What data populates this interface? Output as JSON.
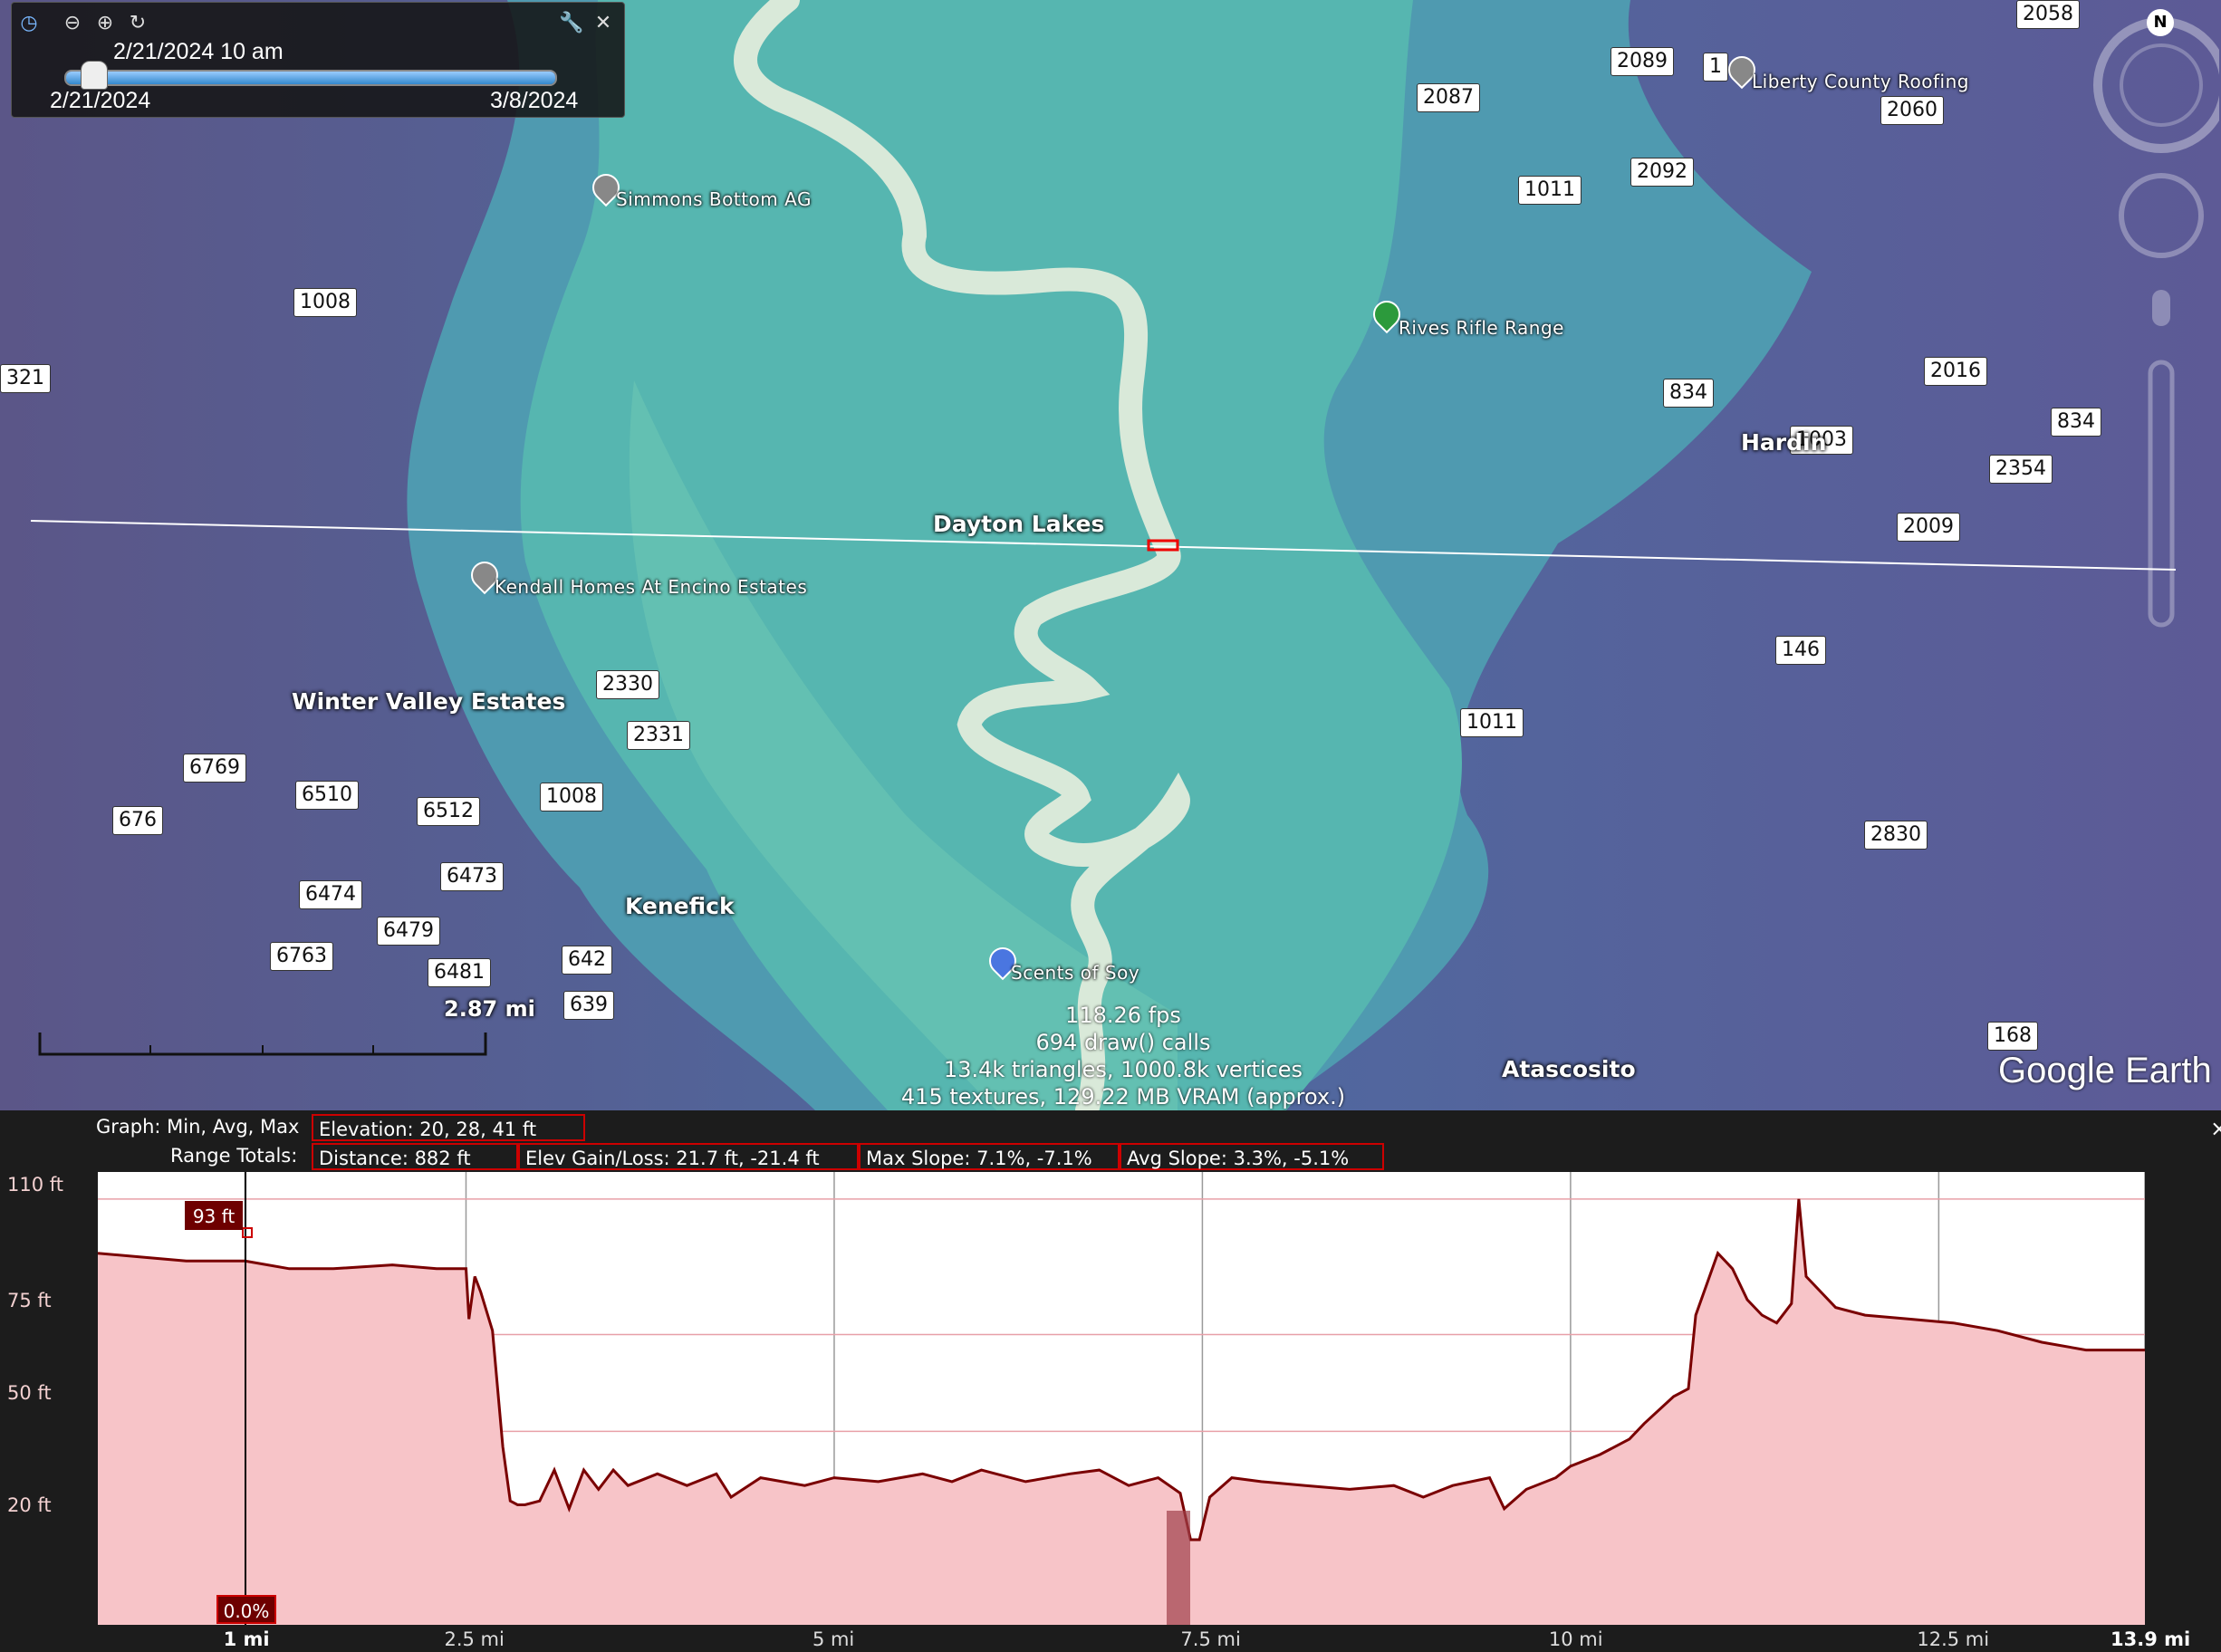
{
  "timebar": {
    "current": "2/21/2024  10 am",
    "start": "2/21/2024",
    "end": "3/8/2024",
    "icons": [
      "clock-icon",
      "zoom-out-icon",
      "zoom-in-icon",
      "refresh-icon",
      "wrench-icon",
      "close-icon"
    ]
  },
  "map": {
    "places": {
      "dayton_lakes": "Dayton Lakes",
      "winter_valley": "Winter Valley Estates",
      "kenefick": "Kenefick",
      "hardin": "Hardin",
      "atascosito": "Atascosito"
    },
    "pois": {
      "simmons": "Simmons Bottom AG",
      "rives": "Rives Rifle Range",
      "kendall": "Kendall Homes At Encino Estates",
      "scents": "Scents of Soy",
      "liberty": "Liberty County Roofing"
    },
    "shields": {
      "r2058": "2058",
      "r2089": "2089",
      "r2087": "2087",
      "r2060": "2060",
      "r2092": "2092",
      "r1011a": "1011",
      "r1008a": "1008",
      "r321": "321",
      "r834a": "834",
      "r2016": "2016",
      "r834b": "834",
      "r1003": "1003",
      "r2354": "2354",
      "r2009": "2009",
      "r146": "146",
      "r2330": "2330",
      "r2331": "2331",
      "r1011b": "1011",
      "r6769": "6769",
      "r676": "676",
      "r6510": "6510",
      "r6512": "6512",
      "r1008b": "1008",
      "r6473": "6473",
      "r6474": "6474",
      "r6479": "6479",
      "r6763": "6763",
      "r6481": "6481",
      "r642": "642",
      "r639": "639",
      "r2830": "2830",
      "r168": "168",
      "r1_": "1"
    },
    "scale": "2.87 mi",
    "stats": [
      "118.26 fps",
      "694 draw() calls",
      "13.4k triangles, 1000.8k vertices",
      "415 textures, 129.22 MB VRAM (approx.)"
    ],
    "brand": "Google Earth",
    "compass_north": "N"
  },
  "profile": {
    "graph_label": "Graph: Min, Avg, Max",
    "elevation": "Elevation: 20, 28, 41 ft",
    "range_label": "Range Totals:",
    "distance": "Distance: 882 ft",
    "gain_loss": "Elev Gain/Loss: 21.7 ft, -21.4 ft",
    "max_slope": "Max Slope: 7.1%, -7.1%",
    "avg_slope": "Avg Slope: 3.3%, -5.1%",
    "cursor_value": "93 ft",
    "cursor_slope": "0.0%",
    "cursor_x": "1 mi",
    "close": "×",
    "colors": {
      "line": "#7a0000",
      "fill": "#f7c4c8",
      "highlight": "#c00000"
    }
  },
  "chart_data": {
    "type": "area",
    "title": "",
    "xlabel": "",
    "ylabel": "",
    "y_ticks": [
      "110 ft",
      "75 ft",
      "50 ft",
      "20 ft"
    ],
    "y_tick_values": [
      110,
      75,
      50,
      20
    ],
    "x_ticks": [
      "1 mi",
      "2.5 mi",
      "5 mi",
      "7.5 mi",
      "10 mi",
      "12.5 mi",
      "13.9 mi"
    ],
    "x_tick_values": [
      1,
      2.5,
      5,
      7.5,
      10,
      12.5,
      13.9
    ],
    "xlim": [
      0,
      13.9
    ],
    "ylim": [
      0,
      117
    ],
    "grid": true,
    "series": [
      {
        "x": [
          0,
          0.3,
          0.6,
          1.0,
          1.3,
          1.6,
          2.0,
          2.3,
          2.5,
          2.52,
          2.56,
          2.6,
          2.68,
          2.75,
          2.8,
          2.85,
          2.9,
          3.0,
          3.1,
          3.2,
          3.3,
          3.4,
          3.5,
          3.6,
          3.8,
          4.0,
          4.2,
          4.3,
          4.5,
          4.8,
          5.0,
          5.3,
          5.6,
          5.8,
          6.0,
          6.3,
          6.6,
          6.8,
          7.0,
          7.2,
          7.35,
          7.42,
          7.48,
          7.55,
          7.7,
          7.9,
          8.2,
          8.5,
          8.8,
          9.0,
          9.2,
          9.45,
          9.55,
          9.7,
          9.9,
          10.0,
          10.2,
          10.4,
          10.5,
          10.7,
          10.8,
          10.85,
          11.0,
          11.1,
          11.2,
          11.3,
          11.4,
          11.5,
          11.55,
          11.6,
          11.8,
          12.0,
          12.3,
          12.6,
          12.9,
          13.2,
          13.5,
          13.9
        ],
        "values": [
          96,
          95,
          94,
          94,
          92,
          92,
          93,
          92,
          92,
          79,
          90,
          86,
          76,
          46,
          32,
          31,
          31,
          32,
          40,
          30,
          40,
          35,
          40,
          36,
          39,
          36,
          39,
          33,
          38,
          36,
          38,
          37,
          39,
          37,
          40,
          37,
          39,
          40,
          36,
          38,
          34,
          22,
          22,
          33,
          38,
          37,
          36,
          35,
          36,
          33,
          36,
          38,
          30,
          35,
          38,
          41,
          44,
          48,
          52,
          59,
          61,
          80,
          96,
          92,
          84,
          80,
          78,
          83,
          110,
          90,
          82,
          80,
          79,
          78,
          76,
          73,
          71,
          71
        ]
      }
    ]
  }
}
